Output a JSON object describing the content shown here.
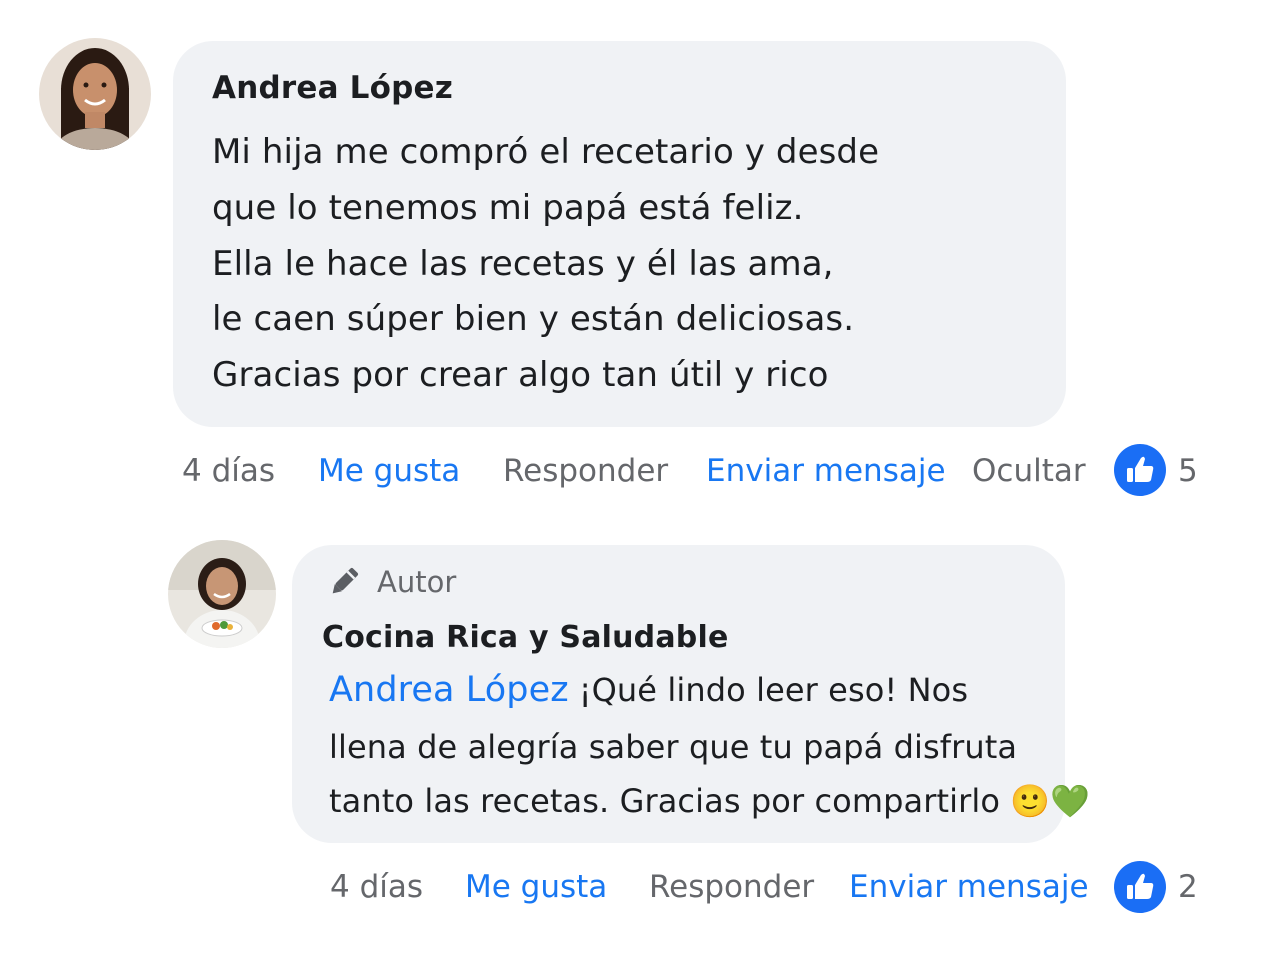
{
  "comment": {
    "author": "Andrea López",
    "lines": [
      "Mi hija me compró el recetario y desde",
      "que lo tenemos mi papá está feliz.",
      "Ella le hace las recetas y él las ama,",
      "le caen súper bien y están deliciosas.",
      "Gracias por crear algo tan útil y rico"
    ],
    "actions": {
      "time": "4 días",
      "like": "Me gusta",
      "reply": "Responder",
      "message": "Enviar mensaje",
      "hide": "Ocultar"
    },
    "like_count": "5"
  },
  "reply": {
    "badge": "Autor",
    "author": "Cocina Rica y Saludable",
    "mention": "Andrea López",
    "first_line_text": "¡Qué lindo leer eso! Nos",
    "lines": [
      "llena de alegría saber que tu papá disfruta",
      "tanto las recetas. Gracias por compartirlo 🙂💚"
    ],
    "actions": {
      "time": "4 días",
      "like": "Me gusta",
      "reply": "Responder",
      "message": "Enviar mensaje"
    },
    "like_count": "2"
  },
  "colors": {
    "link_blue": "#1877f2",
    "muted_gray": "#65676b",
    "bubble_bg": "#f0f2f5",
    "like_blue": "#1a6ef5"
  },
  "icons": {
    "author_badge": "pencil-icon",
    "reaction": "thumbs-up-icon"
  }
}
